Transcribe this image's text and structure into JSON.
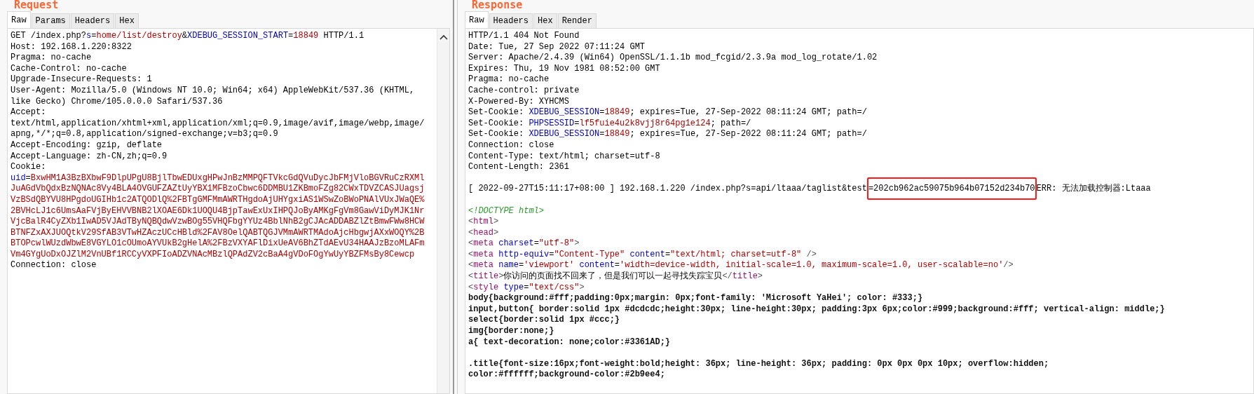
{
  "panes": [
    {
      "title": "Request",
      "has_scrollbar": true,
      "tabs": [
        {
          "label": "Raw",
          "selected": true
        },
        {
          "label": "Params",
          "selected": false
        },
        {
          "label": "Headers",
          "selected": false
        },
        {
          "label": "Hex",
          "selected": false
        }
      ],
      "lines": [
        {
          "segments": [
            {
              "kind": "plain",
              "text": "GET /index.php?"
            },
            {
              "kind": "key",
              "text": "s"
            },
            {
              "kind": "plain",
              "text": "="
            },
            {
              "kind": "value",
              "text": "home/list/destroy"
            },
            {
              "kind": "plain",
              "text": "&"
            },
            {
              "kind": "key",
              "text": "XDEBUG_SESSION_START"
            },
            {
              "kind": "plain",
              "text": "="
            },
            {
              "kind": "value",
              "text": "18849"
            },
            {
              "kind": "plain",
              "text": " HTTP/1.1"
            }
          ]
        },
        {
          "segments": [
            {
              "kind": "plain",
              "text": "Host: 192.168.1.220:8322"
            }
          ]
        },
        {
          "segments": [
            {
              "kind": "plain",
              "text": "Pragma: no-cache"
            }
          ]
        },
        {
          "segments": [
            {
              "kind": "plain",
              "text": "Cache-Control: no-cache"
            }
          ]
        },
        {
          "segments": [
            {
              "kind": "plain",
              "text": "Upgrade-Insecure-Requests: 1"
            }
          ]
        },
        {
          "segments": [
            {
              "kind": "plain",
              "text": "User-Agent: Mozilla/5.0 (Windows NT 10.0; Win64; x64) AppleWebKit/537.36 (KHTML,"
            }
          ]
        },
        {
          "segments": [
            {
              "kind": "plain",
              "text": "like Gecko) Chrome/105.0.0.0 Safari/537.36"
            }
          ]
        },
        {
          "segments": [
            {
              "kind": "plain",
              "text": "Accept:"
            }
          ]
        },
        {
          "segments": [
            {
              "kind": "plain",
              "text": "text/html,application/xhtml+xml,application/xml;q=0.9,image/avif,image/webp,image/"
            }
          ]
        },
        {
          "segments": [
            {
              "kind": "plain",
              "text": "apng,*/*;q=0.8,application/signed-exchange;v=b3;q=0.9"
            }
          ]
        },
        {
          "segments": [
            {
              "kind": "plain",
              "text": "Accept-Encoding: gzip, deflate"
            }
          ]
        },
        {
          "segments": [
            {
              "kind": "plain",
              "text": "Accept-Language: zh-CN,zh;q=0.9"
            }
          ]
        },
        {
          "segments": [
            {
              "kind": "plain",
              "text": "Cookie:"
            }
          ]
        },
        {
          "segments": [
            {
              "kind": "key",
              "text": "uid"
            },
            {
              "kind": "plain",
              "text": "="
            },
            {
              "kind": "value",
              "text": "BxwHM1A3BzBXbwF9DlpUPgU8BjlTbwEDUxgHPwJnBzMMPQFTVkcGdQVuDycJbFMjVloBGVRuCzRXMl"
            }
          ]
        },
        {
          "segments": [
            {
              "kind": "value",
              "text": "JuAGdVbQdxBzNQNAc8Vy4BLA4OVGUFZAZtUyYBX1MFBzoCbwc6DDMBU1ZKBmoFZg82CWxTDVZCASJUagsj"
            }
          ]
        },
        {
          "segments": [
            {
              "kind": "value",
              "text": "VzBSdQBYVU8HPgdoUGIHb1c2ATQODlQ%2FBTgGMFMmAWRTHgdoAjUHYgxiAS1WSwZoBWoPNAlVUxJWaQE%"
            }
          ]
        },
        {
          "segments": [
            {
              "kind": "value",
              "text": "2BVHcLJ1c6UmsAaFVjByEHVVBNB2lXOAE6Dk1UOQU4BjpTawExUxIHPQJoByAMKgFgVm8GawViDyMJK1Nr"
            }
          ]
        },
        {
          "segments": [
            {
              "kind": "value",
              "text": "VjcBalR4CyZXb1IwAD5VJAdTByNQBQdwVzwBOg55VHQFbgYYUz4BblNhB2gCJAcADDABZlZtBmwFWw8HCW"
            }
          ]
        },
        {
          "segments": [
            {
              "kind": "value",
              "text": "BTNFZxAXJUOQtkV29SfAB3VTwHZAczUCcHBld%2FAV8OelQABTQGJVMmAWRTMAdoAjcHbgwjAXxWOQY%2B"
            }
          ]
        },
        {
          "segments": [
            {
              "kind": "value",
              "text": "BTOPcwlWUzdWbwE8VGYLO1cOUmoAYVUkB2gHelA%2FBzVXYAFlDixUeAV6BhZTdAEvU34HAAJzBzoMLAFm"
            }
          ]
        },
        {
          "segments": [
            {
              "kind": "value",
              "text": "Vm4GYgUoDxOJZlM2VnUBf1RCCyVXPFIoADZVNAcMBzlQPAdZV2cBaA4gVDoFOgYwUyYBZFMsBy8Cewcp"
            }
          ]
        },
        {
          "segments": [
            {
              "kind": "plain",
              "text": "Connection: close"
            }
          ]
        }
      ]
    },
    {
      "title": "Response",
      "has_scrollbar": false,
      "tabs": [
        {
          "label": "Raw",
          "selected": true
        },
        {
          "label": "Headers",
          "selected": false
        },
        {
          "label": "Hex",
          "selected": false
        },
        {
          "label": "Render",
          "selected": false
        }
      ],
      "lines": [
        {
          "segments": [
            {
              "kind": "plain",
              "text": "HTTP/1.1 404 Not Found"
            }
          ]
        },
        {
          "segments": [
            {
              "kind": "plain",
              "text": "Date: Tue, 27 Sep 2022 07:11:24 GMT"
            }
          ]
        },
        {
          "segments": [
            {
              "kind": "plain",
              "text": "Server: Apache/2.4.39 (Win64) OpenSSL/1.1.1b mod_fcgid/2.3.9a mod_log_rotate/1.02"
            }
          ]
        },
        {
          "segments": [
            {
              "kind": "plain",
              "text": "Expires: Thu, 19 Nov 1981 08:52:00 GMT"
            }
          ]
        },
        {
          "segments": [
            {
              "kind": "plain",
              "text": "Pragma: no-cache"
            }
          ]
        },
        {
          "segments": [
            {
              "kind": "plain",
              "text": "Cache-control: private"
            }
          ]
        },
        {
          "segments": [
            {
              "kind": "plain",
              "text": "X-Powered-By: XYHCMS"
            }
          ]
        },
        {
          "segments": [
            {
              "kind": "plain",
              "text": "Set-Cookie: "
            },
            {
              "kind": "key",
              "text": "XDEBUG_SESSION"
            },
            {
              "kind": "plain",
              "text": "="
            },
            {
              "kind": "value",
              "text": "18849"
            },
            {
              "kind": "plain",
              "text": "; expires=Tue, 27-Sep-2022 08:11:24 GMT; path=/"
            }
          ]
        },
        {
          "segments": [
            {
              "kind": "plain",
              "text": "Set-Cookie: "
            },
            {
              "kind": "key",
              "text": "PHPSESSID"
            },
            {
              "kind": "plain",
              "text": "="
            },
            {
              "kind": "value",
              "text": "lf5fuie4u2k8vjj8r64pg1e124"
            },
            {
              "kind": "plain",
              "text": "; path=/"
            }
          ]
        },
        {
          "segments": [
            {
              "kind": "plain",
              "text": "Set-Cookie: "
            },
            {
              "kind": "key",
              "text": "XDEBUG_SESSION"
            },
            {
              "kind": "plain",
              "text": "="
            },
            {
              "kind": "value",
              "text": "18849"
            },
            {
              "kind": "plain",
              "text": "; expires=Tue, 27-Sep-2022 08:11:24 GMT; path=/"
            }
          ]
        },
        {
          "segments": [
            {
              "kind": "plain",
              "text": "Connection: close"
            }
          ]
        },
        {
          "segments": [
            {
              "kind": "plain",
              "text": "Content-Type: text/html; charset=utf-8"
            }
          ]
        },
        {
          "segments": [
            {
              "kind": "plain",
              "text": "Content-Length: 2361"
            }
          ]
        },
        {
          "kind": "blank"
        },
        {
          "segments": [
            {
              "kind": "plain",
              "text": "[ 2022-09-27T15:11:17+08:00 ] 192.168.1.220 /index.php?s=api/ltaaa/taglist&test"
            },
            {
              "kind": "highlight",
              "text": "=202cb962ac59075b964b07152d234b70"
            },
            {
              "kind": "plain",
              "text": "ERR: 无法加载控制器:Ltaaa"
            }
          ]
        },
        {
          "kind": "blank"
        },
        {
          "segments": [
            {
              "kind": "comment",
              "text": "<!DOCTYPE html>"
            }
          ]
        },
        {
          "segments": [
            {
              "kind": "punct",
              "text": "<"
            },
            {
              "kind": "tag",
              "text": "html"
            },
            {
              "kind": "punct",
              "text": ">"
            }
          ]
        },
        {
          "segments": [
            {
              "kind": "punct",
              "text": "<"
            },
            {
              "kind": "tag",
              "text": "head"
            },
            {
              "kind": "punct",
              "text": ">"
            }
          ]
        },
        {
          "segments": [
            {
              "kind": "punct",
              "text": "<"
            },
            {
              "kind": "tag",
              "text": "meta"
            },
            {
              "kind": "key",
              "text": " charset"
            },
            {
              "kind": "plain",
              "text": "="
            },
            {
              "kind": "value",
              "text": "\"utf-8\""
            },
            {
              "kind": "punct",
              "text": ">"
            }
          ]
        },
        {
          "segments": [
            {
              "kind": "punct",
              "text": "<"
            },
            {
              "kind": "tag",
              "text": "meta"
            },
            {
              "kind": "key",
              "text": " http-equiv"
            },
            {
              "kind": "plain",
              "text": "="
            },
            {
              "kind": "value",
              "text": "\"Content-Type\""
            },
            {
              "kind": "key",
              "text": " content"
            },
            {
              "kind": "plain",
              "text": "="
            },
            {
              "kind": "value",
              "text": "\"text/html; charset=utf-8\""
            },
            {
              "kind": "punct",
              "text": " />"
            }
          ]
        },
        {
          "segments": [
            {
              "kind": "punct",
              "text": "<"
            },
            {
              "kind": "tag",
              "text": "meta"
            },
            {
              "kind": "key",
              "text": " name"
            },
            {
              "kind": "plain",
              "text": "="
            },
            {
              "kind": "value",
              "text": "'viewport'"
            },
            {
              "kind": "key",
              "text": " content"
            },
            {
              "kind": "plain",
              "text": "="
            },
            {
              "kind": "value",
              "text": "'width=device-width, initial-scale=1.0, maximum-scale=1.0, user-scalable=no'"
            },
            {
              "kind": "punct",
              "text": "/>"
            }
          ]
        },
        {
          "segments": [
            {
              "kind": "punct",
              "text": "<"
            },
            {
              "kind": "tag",
              "text": "title"
            },
            {
              "kind": "punct",
              "text": ">"
            },
            {
              "kind": "plain",
              "text": "你访问的页面找不回来了，但是我们可以一起寻找失踪宝贝"
            },
            {
              "kind": "punct",
              "text": "</"
            },
            {
              "kind": "tag",
              "text": "title"
            },
            {
              "kind": "punct",
              "text": ">"
            }
          ]
        },
        {
          "segments": [
            {
              "kind": "punct",
              "text": "<"
            },
            {
              "kind": "tag",
              "text": "style"
            },
            {
              "kind": "key",
              "text": " type"
            },
            {
              "kind": "plain",
              "text": "="
            },
            {
              "kind": "value",
              "text": "\"text/css\""
            },
            {
              "kind": "punct",
              "text": ">"
            }
          ]
        },
        {
          "segments": [
            {
              "kind": "bold",
              "text": "body{background:#fff;padding:0px;margin: 0px;font-family: 'Microsoft YaHei'; color: #333;}"
            }
          ]
        },
        {
          "segments": [
            {
              "kind": "bold",
              "text": "input,button{ border:solid 1px #dcdcdc;height:30px; line-height:30px; padding:3px 6px;color:#999;background:#fff; vertical-align: middle;}"
            }
          ]
        },
        {
          "segments": [
            {
              "kind": "bold",
              "text": "select{border:solid 1px #ccc;}"
            }
          ]
        },
        {
          "segments": [
            {
              "kind": "bold",
              "text": "img{border:none;}"
            }
          ]
        },
        {
          "segments": [
            {
              "kind": "bold",
              "text": "a{ text-decoration: none;color:#3361AD;}"
            }
          ]
        },
        {
          "kind": "blank"
        },
        {
          "segments": [
            {
              "kind": "bold",
              "text": ".title{font-size:16px;font-weight:bold;height: 36px; line-height: 36px; padding: 0px 0px 0px 10px; overflow:hidden;"
            }
          ]
        },
        {
          "segments": [
            {
              "kind": "bold",
              "text": "color:#ffffff;background-color:#2b9ee4;"
            }
          ]
        }
      ]
    }
  ]
}
